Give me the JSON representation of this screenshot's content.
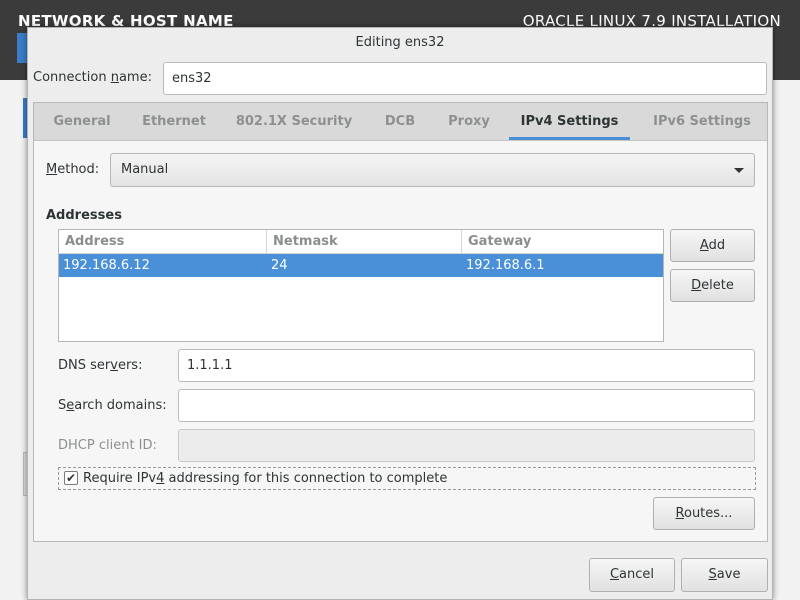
{
  "installer": {
    "section_title": "NETWORK & HOST NAME",
    "product_title": "ORACLE LINUX 7.9 INSTALLATION"
  },
  "dialog": {
    "title": "Editing ens32",
    "connection_name_label_pre": "Connection ",
    "connection_name_label_u": "n",
    "connection_name_label_post": "ame:",
    "connection_name_value": "ens32"
  },
  "tabs": [
    {
      "label": "General",
      "active": false
    },
    {
      "label": "Ethernet",
      "active": false
    },
    {
      "label": "802.1X Security",
      "active": false
    },
    {
      "label": "DCB",
      "active": false
    },
    {
      "label": "Proxy",
      "active": false
    },
    {
      "label": "IPv4 Settings",
      "active": true
    },
    {
      "label": "IPv6 Settings",
      "active": false
    }
  ],
  "ipv4": {
    "method_label_u": "M",
    "method_label_rest": "ethod:",
    "method_value": "Manual",
    "addresses_heading": "Addresses",
    "columns": [
      "Address",
      "Netmask",
      "Gateway"
    ],
    "rows": [
      {
        "address": "192.168.6.12",
        "netmask": "24",
        "gateway": "192.168.6.1",
        "selected": true
      }
    ],
    "add_button_u": "A",
    "add_button_rest": "dd",
    "delete_button_u": "D",
    "delete_button_rest": "elete",
    "dns_label_pre": "DNS ser",
    "dns_label_u": "v",
    "dns_label_post": "ers:",
    "dns_value": "1.1.1.1",
    "search_label_pre": "S",
    "search_label_u": "e",
    "search_label_post": "arch domains:",
    "search_value": "",
    "dhcp_label": "DHCP client ID:",
    "dhcp_value": "",
    "require_checked": true,
    "require_label_pre": "Require IPv",
    "require_label_u": "4",
    "require_label_post": " addressing for this connection to complete",
    "routes_button_u": "R",
    "routes_button_rest": "outes..."
  },
  "footer": {
    "cancel_u": "C",
    "cancel_rest": "ancel",
    "save_u": "S",
    "save_rest": "ave"
  },
  "colors": {
    "accent": "#4a90d9",
    "header_bg": "#3b3b3b"
  }
}
